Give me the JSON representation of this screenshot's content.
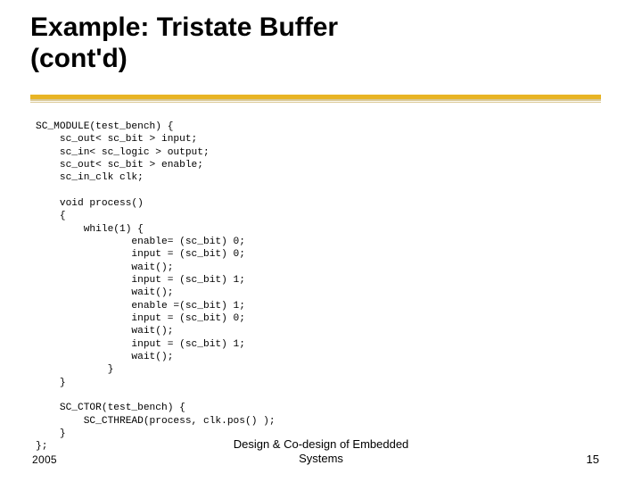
{
  "title_line1": "Example: Tristate Buffer",
  "title_line2": "(cont'd)",
  "code": "SC_MODULE(test_bench) {\n    sc_out< sc_bit > input;\n    sc_in< sc_logic > output;\n    sc_out< sc_bit > enable;\n    sc_in_clk clk;\n\n    void process()\n    {\n        while(1) {\n                enable= (sc_bit) 0;\n                input = (sc_bit) 0;\n                wait();\n                input = (sc_bit) 1;\n                wait();\n                enable =(sc_bit) 1;\n                input = (sc_bit) 0;\n                wait();\n                input = (sc_bit) 1;\n                wait();\n            }\n    }\n\n    SC_CTOR(test_bench) {\n        SC_CTHREAD(process, clk.pos() );\n    }\n};",
  "footer": {
    "year": "2005",
    "center_line1": "Design & Co-design of Embedded",
    "center_line2": "Systems",
    "page": "15"
  }
}
